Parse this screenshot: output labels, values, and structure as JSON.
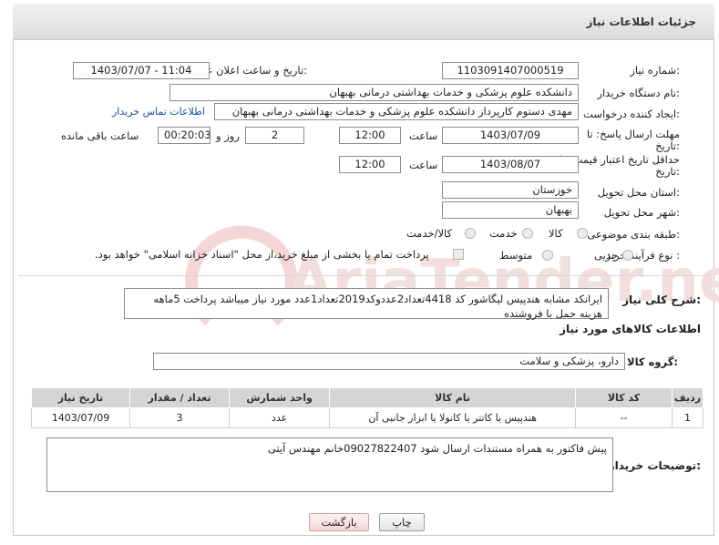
{
  "page_title": "جزئیات اطلاعات نیاز",
  "fields": {
    "need_number_label": "شماره نیاز:",
    "need_number": "1103091407000519",
    "announce_label": "تاریخ و ساعت اعلان عمومی:",
    "announce_value": "1403/07/07 - 11:04",
    "buyer_org_label": "نام دستگاه خریدار:",
    "buyer_org": "دانشکده علوم پزشکی و خدمات بهداشتی  درمانی بهبهان",
    "creator_label": "ایجاد کننده درخواست:",
    "creator": "مهدی دستوم کارپرداز دانشکده علوم پزشکی و خدمات بهداشتی  درمانی بهبهان",
    "contact_link": "اطلاعات تماس خریدار",
    "deadline_label_1": "مهلت ارسال پاسخ: تا",
    "deadline_label_2": "تاریخ:",
    "deadline_date": "1403/07/09",
    "time_label": "ساعت",
    "deadline_time": "12:00",
    "days_value": "2",
    "days_label": "روز و",
    "remaining_time": "00:20:03",
    "remaining_label": "ساعت باقی مانده",
    "validity_label_1": "حداقل تاریخ اعتبار قیمت: تا",
    "validity_label_2": "تاریخ:",
    "validity_date": "1403/08/07",
    "validity_time_label": "ساعت",
    "validity_time": "12:00",
    "province_label": "استان محل تحویل:",
    "province": "خوزستان",
    "city_label": "شهر محل تحویل:",
    "city": "بهبهان",
    "category_label": "طبقه بندی موضوعی:",
    "category_options": [
      "کالا",
      "خدمت",
      "کالا/خدمت"
    ],
    "purchase_type_label": "نوع فرآیند خرید :",
    "purchase_options": [
      "جزیی",
      "متوسط"
    ],
    "payment_note": "پرداخت تمام یا بخشی از مبلغ خرید،از محل \"اسناد خزانه اسلامی\" خواهد بود."
  },
  "description": {
    "label": "شرح کلی نیاز:",
    "text": "ایرانکد مشابه هندپیس لیگاشور کد 4418تعداد2عددوکد2019تعداد1عدد مورد نیاز میباشد پرداخت 5ماهه هزینه حمل با فروشنده"
  },
  "goods_section": {
    "title": "اطلاعات کالاهای مورد نیاز",
    "group_label": "گروه کالا:",
    "group_value": "دارو، پزشکی و سلامت"
  },
  "table": {
    "headers": [
      "ردیف",
      "کد کالا",
      "نام کالا",
      "واحد شمارش",
      "تعداد / مقدار",
      "تاریخ نیاز"
    ],
    "rows": [
      [
        "1",
        "--",
        "هندپیس یا کاتتر یا کانولا یا ابزار جانبی آن",
        "عدد",
        "3",
        "1403/07/09"
      ]
    ]
  },
  "buyer_notes": {
    "label": "توضیحات خریدار:",
    "text": "پیش فاکتور به همراه مستندات ارسال شود 09027822407خانم مهندس آیتی"
  },
  "buttons": {
    "print": "چاپ",
    "back": "بازگشت"
  },
  "watermark": "AriaTender.neT",
  "colors": {
    "link": "#1a4fa0",
    "header_bg": "#dcdcdc",
    "table_header_bg": "#d5d5d5",
    "back_button_bg": "#f5d7d7",
    "watermark": "#f3d6d6"
  }
}
